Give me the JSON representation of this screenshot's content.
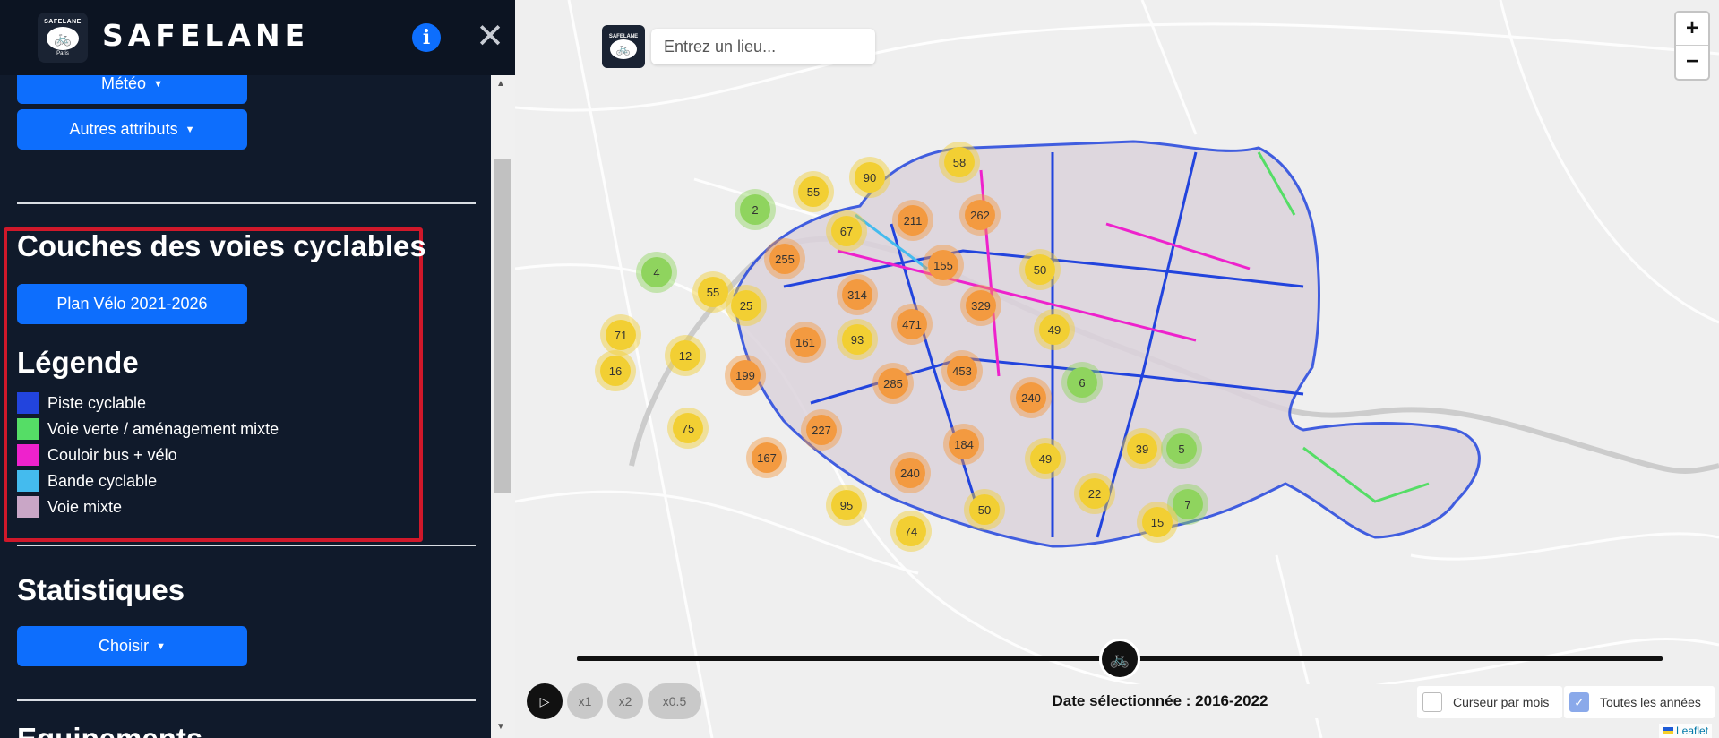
{
  "sidebar": {
    "brand": "SAFELANE",
    "logo_text_top": "SAFELANE",
    "logo_text_bottom": "Paris",
    "info_label": "i",
    "close_label": "✕",
    "buttons": {
      "meteo": "Météo",
      "autres_attributs": "Autres attributs",
      "plan_velo": "Plan Vélo 2021-2026",
      "choisir": "Choisir"
    },
    "headings": {
      "couches": "Couches des voies cyclables",
      "legende": "Légende",
      "statistiques": "Statistiques",
      "next": "Equipements"
    },
    "legend": [
      {
        "label": "Piste cyclable",
        "color": "#2244dd"
      },
      {
        "label": "Voie verte / aménagement mixte",
        "color": "#55dd66"
      },
      {
        "label": "Couloir bus + vélo",
        "color": "#ee22cc"
      },
      {
        "label": "Bande cyclable",
        "color": "#44bbee"
      },
      {
        "label": "Voie mixte",
        "color": "#c9a6c6"
      }
    ],
    "highlight_color": "#d0182a"
  },
  "map": {
    "search_placeholder": "Entrez un lieu...",
    "zoom_in": "+",
    "zoom_out": "−",
    "play_icon": "▷",
    "speeds": [
      "x1",
      "x2",
      "x0.5"
    ],
    "date_label": "Date sélectionnée : 2016-2022",
    "checkbox_month": "Curseur par mois",
    "checkbox_all_years": "Toutes les années",
    "checkbox_month_checked": false,
    "checkbox_all_years_checked": true,
    "attribution": "Leaflet",
    "clusters": [
      {
        "n": "58",
        "c": "yellow"
      },
      {
        "n": "90",
        "c": "yellow"
      },
      {
        "n": "55",
        "c": "yellow"
      },
      {
        "n": "2",
        "c": "green"
      },
      {
        "n": "211",
        "c": "orange"
      },
      {
        "n": "262",
        "c": "orange"
      },
      {
        "n": "67",
        "c": "yellow"
      },
      {
        "n": "255",
        "c": "orange"
      },
      {
        "n": "155",
        "c": "orange"
      },
      {
        "n": "50",
        "c": "yellow"
      },
      {
        "n": "4",
        "c": "green"
      },
      {
        "n": "55",
        "c": "yellow"
      },
      {
        "n": "25",
        "c": "yellow"
      },
      {
        "n": "314",
        "c": "orange"
      },
      {
        "n": "329",
        "c": "orange"
      },
      {
        "n": "471",
        "c": "orange"
      },
      {
        "n": "49",
        "c": "yellow"
      },
      {
        "n": "71",
        "c": "yellow"
      },
      {
        "n": "161",
        "c": "orange"
      },
      {
        "n": "93",
        "c": "yellow"
      },
      {
        "n": "12",
        "c": "yellow"
      },
      {
        "n": "16",
        "c": "yellow"
      },
      {
        "n": "199",
        "c": "orange"
      },
      {
        "n": "453",
        "c": "orange"
      },
      {
        "n": "6",
        "c": "green"
      },
      {
        "n": "285",
        "c": "orange"
      },
      {
        "n": "240",
        "c": "orange"
      },
      {
        "n": "75",
        "c": "yellow"
      },
      {
        "n": "227",
        "c": "orange"
      },
      {
        "n": "39",
        "c": "yellow"
      },
      {
        "n": "5",
        "c": "green"
      },
      {
        "n": "184",
        "c": "orange"
      },
      {
        "n": "167",
        "c": "orange"
      },
      {
        "n": "49",
        "c": "yellow"
      },
      {
        "n": "240",
        "c": "orange"
      },
      {
        "n": "22",
        "c": "yellow"
      },
      {
        "n": "7",
        "c": "green"
      },
      {
        "n": "95",
        "c": "yellow"
      },
      {
        "n": "50",
        "c": "yellow"
      },
      {
        "n": "15",
        "c": "yellow"
      },
      {
        "n": "74",
        "c": "yellow"
      }
    ],
    "cluster_colors": {
      "yellow": "#f2cf33",
      "orange": "#f39a40",
      "green": "#8fd45e"
    }
  }
}
